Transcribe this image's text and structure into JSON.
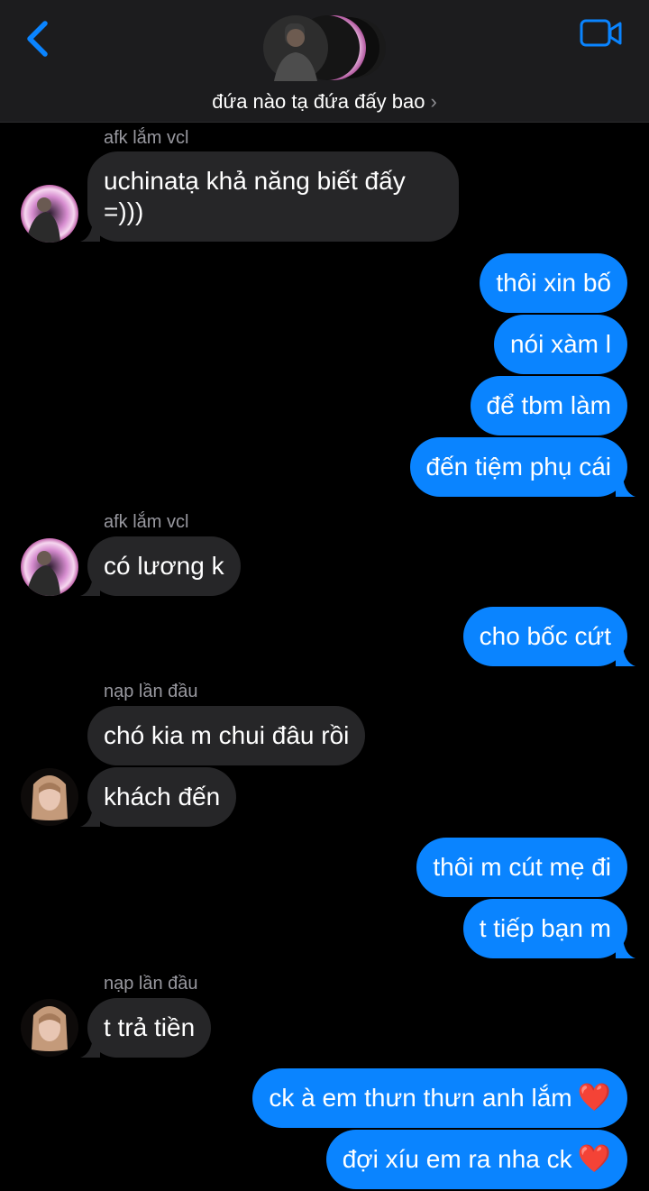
{
  "header": {
    "title": "đứa nào tạ đứa đấy bao",
    "chevron": "›",
    "back_icon": "chevron-left-icon",
    "video_icon": "video-camera-icon",
    "accent": "#0a84ff"
  },
  "messages": [
    {
      "sender": "afk lắm vcl",
      "direction": "in",
      "text": "uchinatạ khả năng biết đấy =)))"
    },
    {
      "direction": "out",
      "text": "thôi xin bố"
    },
    {
      "direction": "out",
      "text": "nói xàm l"
    },
    {
      "direction": "out",
      "text": "để tbm làm"
    },
    {
      "direction": "out",
      "text": "đến tiệm phụ cái"
    },
    {
      "sender": "afk lắm vcl",
      "direction": "in",
      "text": "có lương k"
    },
    {
      "direction": "out",
      "text": "cho bốc cứt"
    },
    {
      "sender": "nạp lần đầu",
      "direction": "in",
      "text": "chó kia m chui đâu rồi"
    },
    {
      "direction": "in",
      "text": "khách đến"
    },
    {
      "direction": "out",
      "text": "thôi m cút mẹ đi"
    },
    {
      "direction": "out",
      "text": "t tiếp bạn m"
    },
    {
      "sender": "nạp lần đầu",
      "direction": "in",
      "text": "t trả tiền"
    },
    {
      "direction": "out",
      "text": "ck à em thưn thưn anh lắm",
      "emoji": "❤️"
    },
    {
      "direction": "out",
      "text": "đợi xíu em ra nha ck",
      "emoji": "❤️"
    }
  ]
}
